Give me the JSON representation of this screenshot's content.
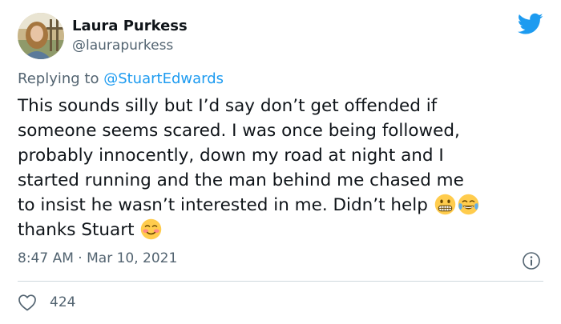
{
  "author": {
    "name": "Laura Purkess",
    "handle": "@laurapurkess"
  },
  "reply": {
    "prefix": "Replying to ",
    "mention": "@StuartEdwards"
  },
  "tweet": {
    "text_main": "This sounds silly but I’d say don’t get offended if\nsomeone seems scared. I was once being followed,\nprobably innocently, down my road at night and I\nstarted running and the man behind me chased me\nto insist he wasn’t interested in me. Didn’t help ",
    "text_end": " thanks Stuart ",
    "emojis": [
      "grimacing-face-emoji",
      "tears-of-joy-emoji",
      "smiling-face-emoji"
    ]
  },
  "meta": {
    "time": "8:47 AM",
    "separator": " · ",
    "date": "Mar 10, 2021"
  },
  "engagement": {
    "likes": "424"
  },
  "colors": {
    "brand": "#1d9bf0",
    "text": "#0f1419",
    "secondary": "#536471",
    "divider": "#cfd9de"
  },
  "icons": {
    "logo": "twitter-bird-icon",
    "info": "info-icon",
    "like": "heart-icon"
  }
}
